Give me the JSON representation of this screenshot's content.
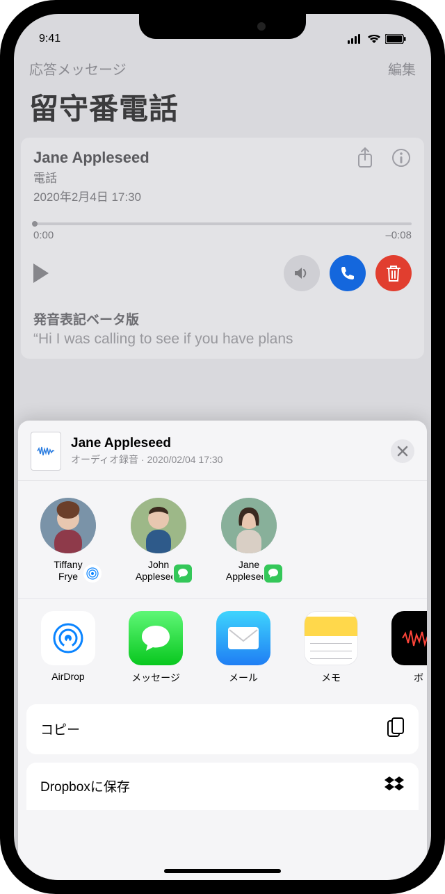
{
  "status": {
    "time": "9:41"
  },
  "nav": {
    "back": "応答メッセージ",
    "edit": "編集",
    "title": "留守番電話"
  },
  "voicemail": {
    "name": "Jane Appleseed",
    "line": "電話",
    "datetime": "2020年2月4日 17:30",
    "elapsed": "0:00",
    "remaining": "–0:08",
    "transcript_label": "発音表記ベータ版",
    "transcript": "“Hi I was calling to see if you have plans"
  },
  "share": {
    "title": "Jane Appleseed",
    "subtitle": "オーディオ録音 · 2020/02/04 17:30",
    "contacts": [
      {
        "name": "Tiffany\nFrye",
        "badge": "airdrop"
      },
      {
        "name": "John\nAppleseed",
        "badge": "msg"
      },
      {
        "name": "Jane\nAppleseed",
        "badge": "msg"
      }
    ],
    "apps": [
      {
        "label": "AirDrop",
        "kind": "airdrop"
      },
      {
        "label": "メッセージ",
        "kind": "messages"
      },
      {
        "label": "メール",
        "kind": "mail"
      },
      {
        "label": "メモ",
        "kind": "notes"
      },
      {
        "label": "ボ",
        "kind": "voice"
      }
    ],
    "actions": {
      "copy": "コピー",
      "dropbox": "Dropboxに保存"
    }
  }
}
